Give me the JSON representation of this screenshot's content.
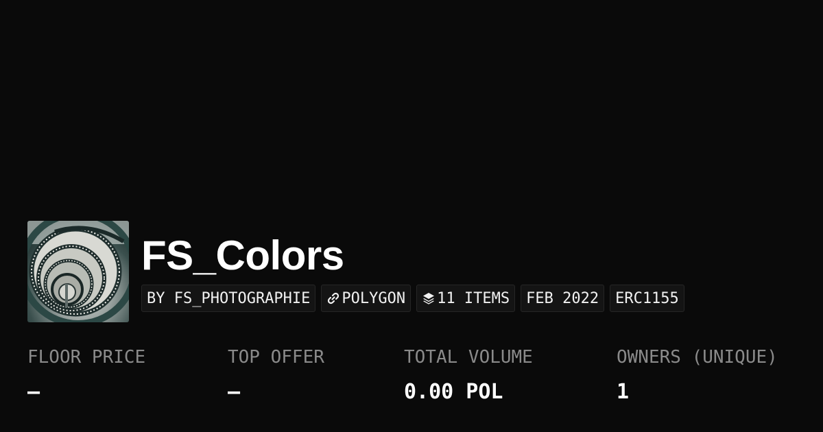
{
  "collection": {
    "title": "FS_Colors",
    "avatar_icon": "spiral-staircase-image"
  },
  "tags": {
    "creator": "BY FS_PHOTOGRAPHIE",
    "chain": "POLYGON",
    "chain_icon": "link-icon",
    "items": "11 ITEMS",
    "items_icon": "layers-icon",
    "date": "FEB 2022",
    "standard": "ERC1155"
  },
  "stats": {
    "floor_price": {
      "label": "FLOOR PRICE",
      "value": "–"
    },
    "top_offer": {
      "label": "TOP OFFER",
      "value": "–"
    },
    "total_volume": {
      "label": "TOTAL VOLUME",
      "value": "0.00 POL"
    },
    "owners": {
      "label": "OWNERS (UNIQUE)",
      "value": "1"
    }
  },
  "colors": {
    "background": "#0a0a0a",
    "label": "#8a8a8a",
    "text": "#ffffff",
    "tag_bg": "#141414"
  }
}
